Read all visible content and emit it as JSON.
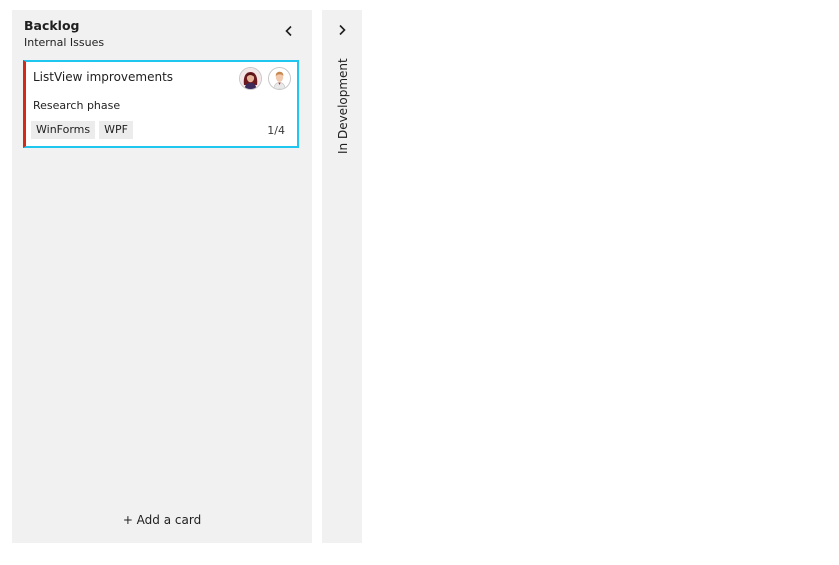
{
  "columns": [
    {
      "title": "Backlog",
      "subtitle": "Internal Issues",
      "collapse_icon": "chevron-left-icon",
      "cards": [
        {
          "title": "ListView improvements",
          "description": "Research phase",
          "tags": [
            "WinForms",
            "WPF"
          ],
          "progress": "1/4",
          "accent_color": "#d42a1a",
          "selected_border_color": "#1fc6ef",
          "assignees": [
            "avatar-woman-icon",
            "avatar-man-icon"
          ]
        }
      ],
      "add_card_label": "+ Add a card"
    },
    {
      "title": "In Development",
      "collapsed": true,
      "expand_icon": "chevron-right-icon"
    }
  ],
  "colors": {
    "column_bg": "#f1f1f1",
    "page_bg": "#ffffff",
    "tag_bg": "#ececec"
  }
}
